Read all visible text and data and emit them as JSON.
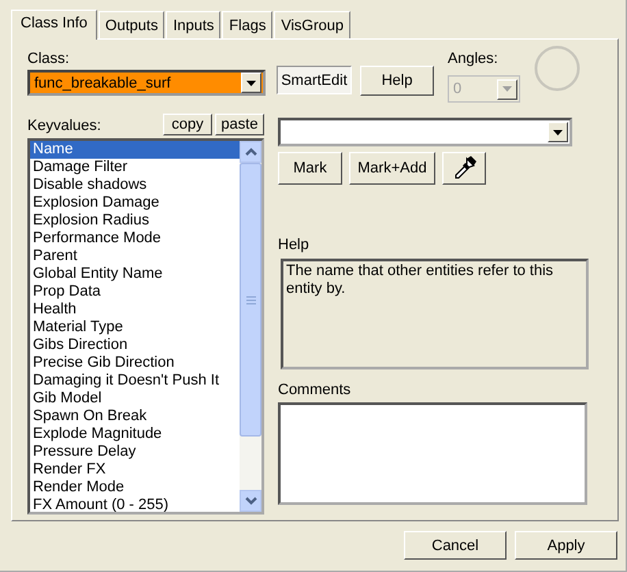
{
  "tabs": [
    {
      "label": "Class Info",
      "selected": true
    },
    {
      "label": "Outputs",
      "selected": false
    },
    {
      "label": "Inputs",
      "selected": false
    },
    {
      "label": "Flags",
      "selected": false
    },
    {
      "label": "VisGroup",
      "selected": false
    }
  ],
  "class": {
    "label": "Class:",
    "value": "func_breakable_surf"
  },
  "smartedit": {
    "label": "SmartEdit",
    "pressed": true
  },
  "help_button": "Help",
  "angles": {
    "label": "Angles:",
    "value": "0",
    "disabled": true
  },
  "keyvalues": {
    "label": "Keyvalues:",
    "copy": "copy",
    "paste": "paste",
    "items": [
      {
        "label": "Name",
        "selected": true
      },
      {
        "label": "Damage Filter",
        "selected": false
      },
      {
        "label": "Disable shadows",
        "selected": false
      },
      {
        "label": "Explosion Damage",
        "selected": false
      },
      {
        "label": "Explosion Radius",
        "selected": false
      },
      {
        "label": "Performance Mode",
        "selected": false
      },
      {
        "label": "Parent",
        "selected": false
      },
      {
        "label": "Global Entity Name",
        "selected": false
      },
      {
        "label": "Prop Data",
        "selected": false
      },
      {
        "label": "Health",
        "selected": false
      },
      {
        "label": "Material Type",
        "selected": false
      },
      {
        "label": "Gibs Direction",
        "selected": false
      },
      {
        "label": "Precise Gib Direction",
        "selected": false
      },
      {
        "label": "Damaging it Doesn't Push It",
        "selected": false
      },
      {
        "label": "Gib Model",
        "selected": false
      },
      {
        "label": "Spawn On Break",
        "selected": false
      },
      {
        "label": "Explode Magnitude",
        "selected": false
      },
      {
        "label": "Pressure Delay",
        "selected": false
      },
      {
        "label": "Render FX",
        "selected": false
      },
      {
        "label": "Render Mode",
        "selected": false
      },
      {
        "label": "FX Amount (0 - 255)",
        "selected": false
      }
    ]
  },
  "mark": "Mark",
  "mark_add": "Mark+Add",
  "help": {
    "label": "Help",
    "text": "The name that other entities refer to this entity by."
  },
  "comments": {
    "label": "Comments"
  },
  "buttons": [
    "Cancel",
    "Apply"
  ]
}
